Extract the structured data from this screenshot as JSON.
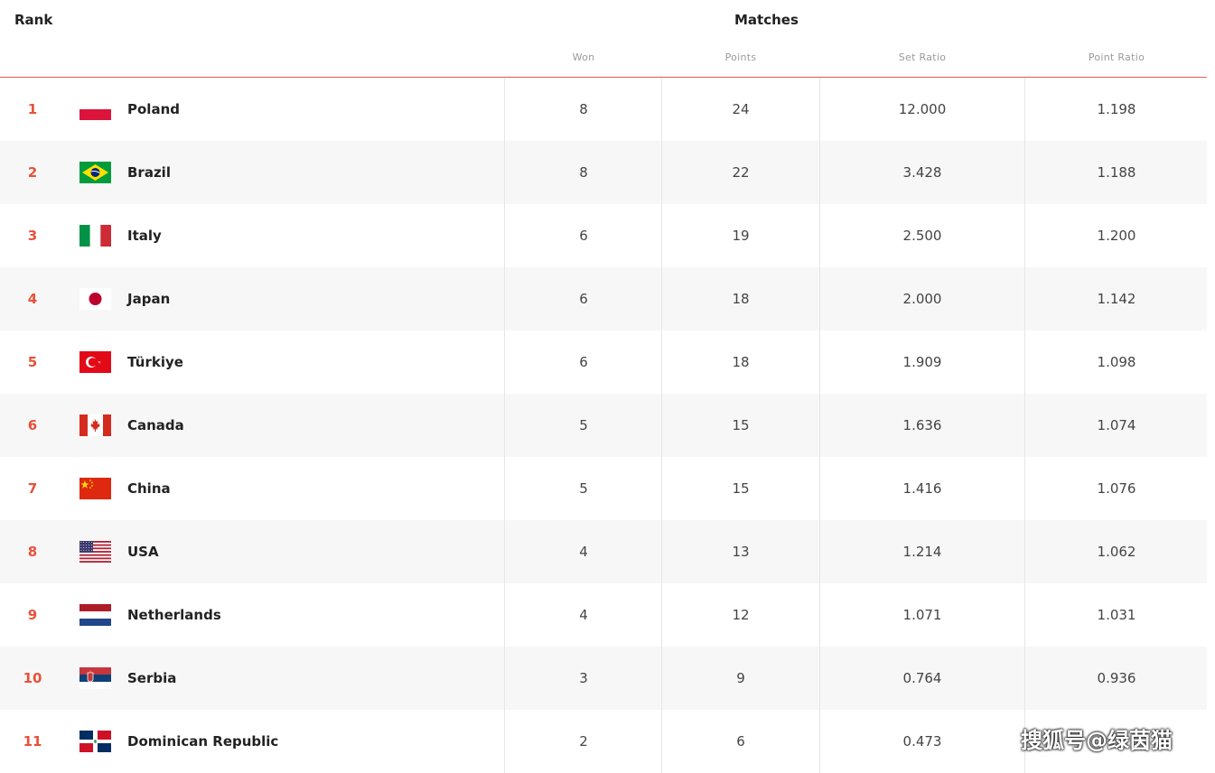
{
  "header": {
    "rank_label": "Rank",
    "matches_label": "Matches",
    "columns": {
      "won": "Won",
      "points": "Points",
      "set_ratio": "Set Ratio",
      "point_ratio": "Point Ratio"
    }
  },
  "rows": [
    {
      "rank": "1",
      "country": "Poland",
      "flag": "poland-flag-icon",
      "won": "8",
      "points": "24",
      "set_ratio": "12.000",
      "point_ratio": "1.198"
    },
    {
      "rank": "2",
      "country": "Brazil",
      "flag": "brazil-flag-icon",
      "won": "8",
      "points": "22",
      "set_ratio": "3.428",
      "point_ratio": "1.188"
    },
    {
      "rank": "3",
      "country": "Italy",
      "flag": "italy-flag-icon",
      "won": "6",
      "points": "19",
      "set_ratio": "2.500",
      "point_ratio": "1.200"
    },
    {
      "rank": "4",
      "country": "Japan",
      "flag": "japan-flag-icon",
      "won": "6",
      "points": "18",
      "set_ratio": "2.000",
      "point_ratio": "1.142"
    },
    {
      "rank": "5",
      "country": "Türkiye",
      "flag": "turkiye-flag-icon",
      "won": "6",
      "points": "18",
      "set_ratio": "1.909",
      "point_ratio": "1.098"
    },
    {
      "rank": "6",
      "country": "Canada",
      "flag": "canada-flag-icon",
      "won": "5",
      "points": "15",
      "set_ratio": "1.636",
      "point_ratio": "1.074"
    },
    {
      "rank": "7",
      "country": "China",
      "flag": "china-flag-icon",
      "won": "5",
      "points": "15",
      "set_ratio": "1.416",
      "point_ratio": "1.076"
    },
    {
      "rank": "8",
      "country": "USA",
      "flag": "usa-flag-icon",
      "won": "4",
      "points": "13",
      "set_ratio": "1.214",
      "point_ratio": "1.062"
    },
    {
      "rank": "9",
      "country": "Netherlands",
      "flag": "netherlands-flag-icon",
      "won": "4",
      "points": "12",
      "set_ratio": "1.071",
      "point_ratio": "1.031"
    },
    {
      "rank": "10",
      "country": "Serbia",
      "flag": "serbia-flag-icon",
      "won": "3",
      "points": "9",
      "set_ratio": "0.764",
      "point_ratio": "0.936"
    },
    {
      "rank": "11",
      "country": "Dominican Republic",
      "flag": "dominican-republic-flag-icon",
      "won": "2",
      "points": "6",
      "set_ratio": "0.473",
      "point_ratio": ""
    }
  ],
  "watermark": "搜狐号@绿茵猫",
  "colors": {
    "accent": "#e8513a",
    "header_rule": "#e8614d",
    "alt_row": "#f7f7f7"
  }
}
